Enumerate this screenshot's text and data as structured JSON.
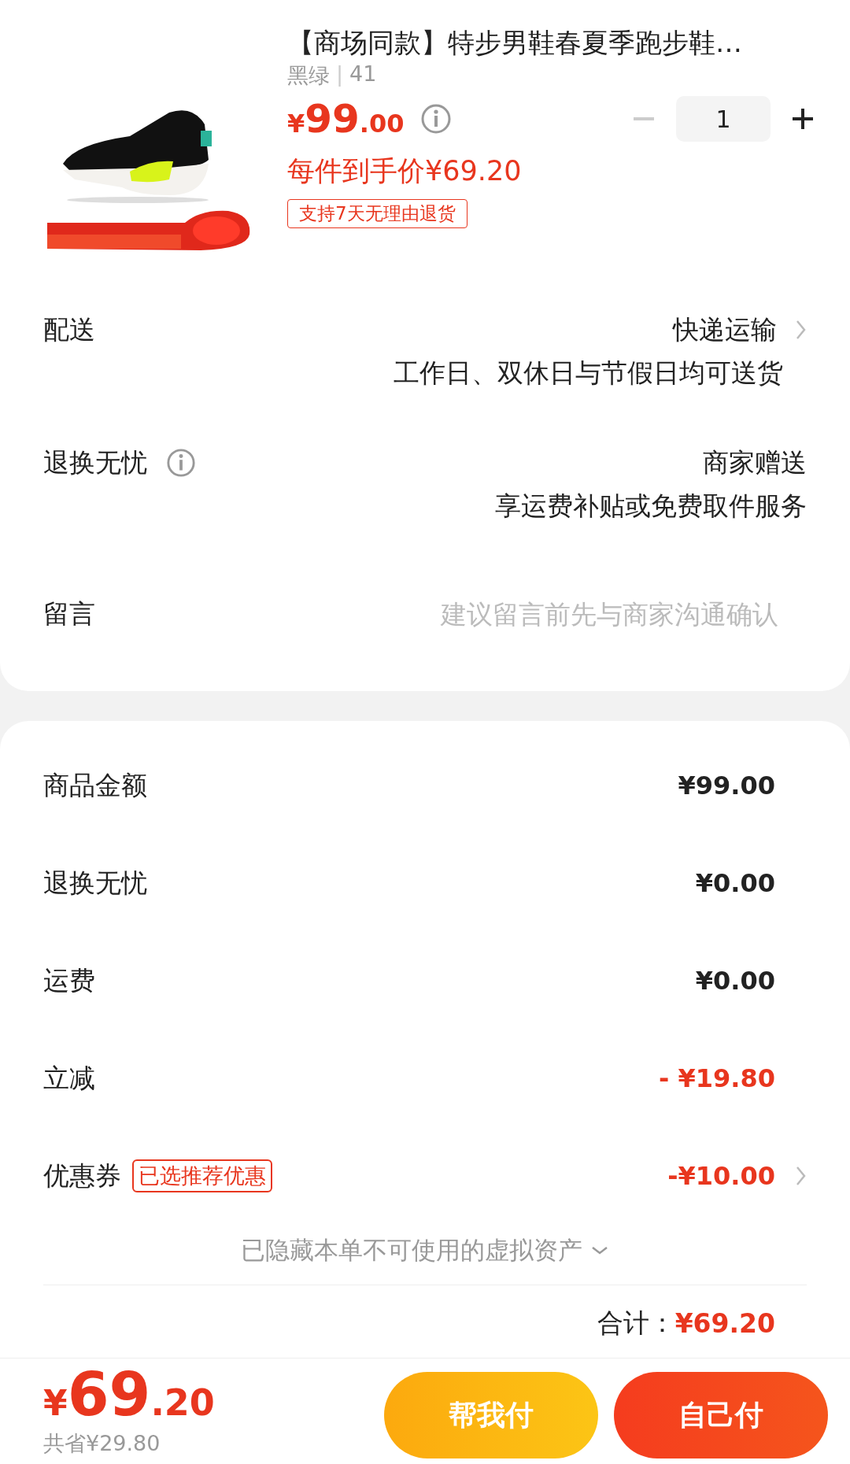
{
  "product": {
    "title": "【商场同款】特步男鞋春夏季跑步鞋…",
    "spec_color": "黑绿",
    "spec_separator": "|",
    "spec_size": "41",
    "price_symbol": "¥",
    "price_int": "99",
    "price_dec": ".00",
    "quantity": "1",
    "minus_disabled": true,
    "final_price": "每件到手价¥69.20",
    "return_tag": "支持7天无理由退货"
  },
  "options": [
    {
      "label": "配送",
      "value": "快递运输",
      "sub": "工作日、双休日与节假日均可送货",
      "arrow": true
    },
    {
      "label": "退换无忧",
      "info": true,
      "value": "商家赠送",
      "sub": "享运费补贴或免费取件服务"
    }
  ],
  "message": {
    "label": "留言",
    "placeholder": "建议留言前先与商家沟通确认"
  },
  "costs": [
    {
      "label": "商品金额",
      "value": "¥99.00",
      "kind": "normal"
    },
    {
      "label": "退换无忧",
      "value": "¥0.00",
      "kind": "normal"
    },
    {
      "label": "运费",
      "value": "¥0.00",
      "kind": "normal"
    },
    {
      "label": "立减",
      "value": "- ¥19.80",
      "kind": "discount"
    },
    {
      "label": "优惠券",
      "value": "-¥10.00",
      "kind": "discount",
      "tag": "已选推荐优惠",
      "arrow": true
    }
  ],
  "hidden_assets": "已隐藏本单不可使用的虚拟资产",
  "total": {
    "label": "合计：",
    "value": "¥69.20"
  },
  "footer": {
    "symbol": "¥",
    "int": "69",
    "dec": ".20",
    "saved": "共省¥29.80",
    "buttons": [
      {
        "label": "帮我付",
        "kind": "friend"
      },
      {
        "label": "自己付",
        "kind": "self"
      }
    ]
  }
}
